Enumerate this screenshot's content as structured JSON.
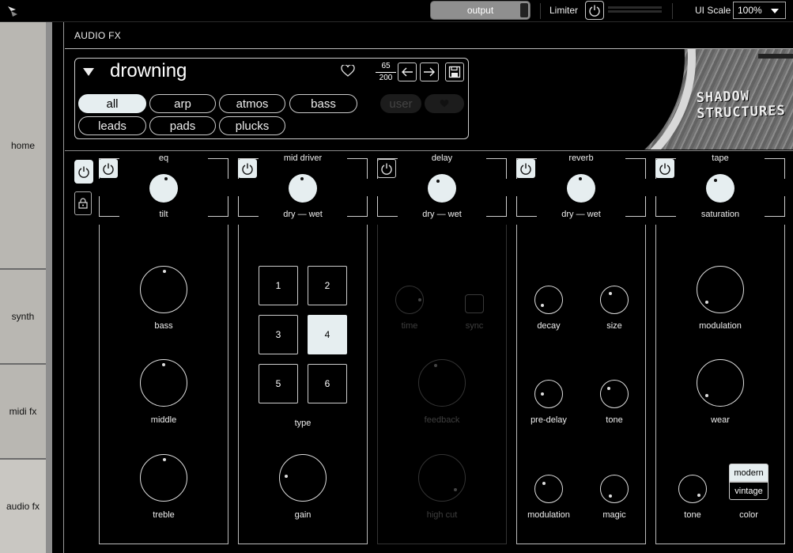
{
  "topbar": {
    "output_label": "output",
    "limiter_label": "Limiter",
    "ui_scale_label": "UI Scale",
    "ui_scale_value": "100%"
  },
  "nav": {
    "items": [
      {
        "label": "home",
        "active": false
      },
      {
        "label": "synth",
        "active": false
      },
      {
        "label": "midi fx",
        "active": false
      },
      {
        "label": "audio fx",
        "active": true
      }
    ]
  },
  "section_title": "AUDIO FX",
  "preset": {
    "name": "drowning",
    "index": "65",
    "total": "200",
    "tags": [
      "all",
      "arp",
      "atmos",
      "bass",
      "leads",
      "pads",
      "plucks"
    ],
    "selected_tag": "all",
    "filter_user": "user",
    "artwork_text_line1": "SHADOW",
    "artwork_text_line2": "STRUCTURES"
  },
  "modules": {
    "eq": {
      "title": "eq",
      "sub": "tilt",
      "knobs": [
        "bass",
        "middle",
        "treble"
      ]
    },
    "mid_driver": {
      "title": "mid driver",
      "sub": "dry — wet",
      "types": [
        "1",
        "2",
        "3",
        "4",
        "5",
        "6"
      ],
      "selected_type": "4",
      "type_label": "type",
      "gain_label": "gain"
    },
    "delay": {
      "title": "delay",
      "sub": "dry — wet",
      "time_label": "time",
      "sync_label": "sync",
      "feedback_label": "feedback",
      "highcut_label": "high cut",
      "enabled": false
    },
    "reverb": {
      "title": "reverb",
      "sub": "dry — wet",
      "knobs": [
        "decay",
        "size",
        "pre-delay",
        "tone",
        "modulation",
        "magic"
      ]
    },
    "tape": {
      "title": "tape",
      "sub": "saturation",
      "modulation_label": "modulation",
      "wear_label": "wear",
      "tone_label": "tone",
      "color_label": "color",
      "color_options": [
        "modern",
        "vintage"
      ],
      "color_selected": "modern"
    }
  },
  "colors": {
    "accent": "#e6eef0",
    "background": "#000000",
    "nav": "#b9b7b2"
  },
  "icons": [
    "power-icon",
    "lock-icon",
    "heart-icon",
    "arrow-left-icon",
    "arrow-right-icon",
    "save-icon",
    "triangle-down-icon",
    "logo-icon"
  ]
}
